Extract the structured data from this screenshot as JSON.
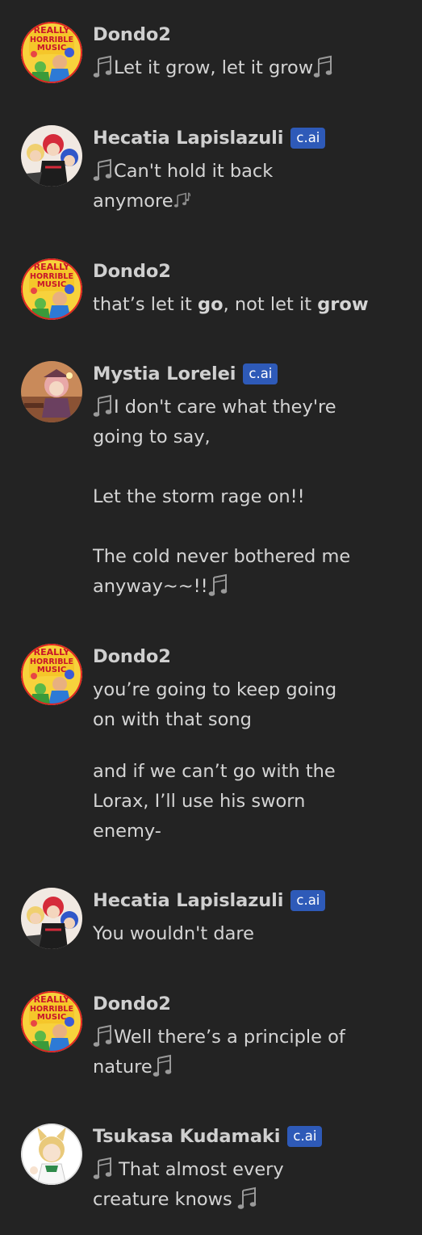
{
  "badge_label": "c.ai",
  "messages": [
    {
      "name": "Dondo2",
      "avatar": "reallyhorriblemusic-avatar",
      "text": [
        "Let it grow, let it grow"
      ]
    },
    {
      "name": "Hecatia Lapislazuli",
      "avatar": "hecatia-avatar",
      "badge": "c.ai",
      "text": [
        "Can't hold it back",
        "anymore"
      ]
    },
    {
      "name": "Dondo2",
      "avatar": "reallyhorriblemusic-avatar",
      "text_parts": [
        "that’s let it ",
        "go",
        ", not let it ",
        "grow"
      ]
    },
    {
      "name": "Mystia Lorelei",
      "avatar": "mystia-avatar",
      "badge": "c.ai",
      "text": [
        "I don't care what they're",
        "going to say,",
        "Let the storm rage on!!",
        "The cold never bothered me",
        "anyway~~!!"
      ]
    },
    {
      "name": "Dondo2",
      "avatar": "reallyhorriblemusic-avatar",
      "text": [
        "you’re going to keep going",
        "on with that song",
        "and if we can’t go with the",
        "Lorax, I’ll use his sworn",
        "enemy-"
      ]
    },
    {
      "name": "Hecatia Lapislazuli",
      "avatar": "hecatia-avatar",
      "badge": "c.ai",
      "text": [
        "You wouldn't dare"
      ]
    },
    {
      "name": "Dondo2",
      "avatar": "reallyhorriblemusic-avatar",
      "text": [
        "Well there’s a principle of",
        "nature"
      ]
    },
    {
      "name": "Tsukasa Kudamaki",
      "avatar": "tsukasa-avatar",
      "badge": "c.ai",
      "text": [
        "That almost every",
        "creature knows"
      ]
    }
  ],
  "avatar_logo_text": [
    "REALLY",
    "HORRIBLE",
    "MUSIC"
  ],
  "colors": {
    "background": "#232323",
    "badge": "#2e5ab8",
    "name": "#cfcfcf",
    "text": "#d4d4d4"
  }
}
